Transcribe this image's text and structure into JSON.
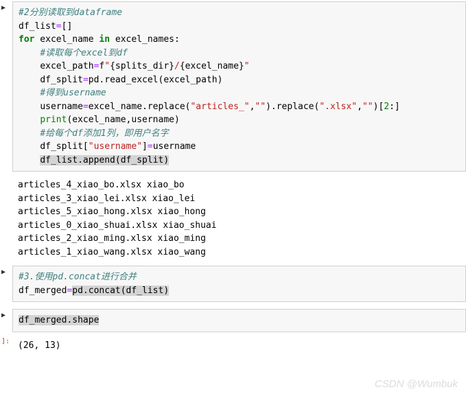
{
  "cell1": {
    "comment1": "#2分别读取到dataframe",
    "line2a": "df_list",
    "line2b": "=",
    "line2c": "[]",
    "kw_for": "for",
    "var_excel_name": " excel_name ",
    "kw_in": "in",
    "var_excel_names": " excel_names:",
    "comment2": "#读取每个excel到df",
    "line5a": "excel_path",
    "line5b": "=",
    "line5c": "f",
    "str5a": "\"",
    "line5d": "{splits_dir}",
    "str5b": "/",
    "line5e": "{excel_name}",
    "str5c": "\"",
    "line6a": "df_split",
    "line6b": "=",
    "line6c": "pd.read_excel(excel_path)",
    "comment3": "#得到username",
    "line8a": "username",
    "line8b": "=",
    "line8c": "excel_name.replace(",
    "str8a": "\"articles_\"",
    "line8d": ",",
    "str8b": "\"\"",
    "line8e": ").replace(",
    "str8c": "\".xlsx\"",
    "line8f": ",",
    "str8d": "\"\"",
    "line8g": ")[",
    "num8": "2",
    "line8h": ":]",
    "builtin_print": "print",
    "line9a": "(excel_name,username)",
    "comment4": "#给每个df添加1列，即用户名字",
    "line11a": "df_split[",
    "str11": "\"username\"",
    "line11b": "]",
    "line11c": "=",
    "line11d": "username",
    "line12": "df_list.append(df_split)"
  },
  "output1": "articles_4_xiao_bo.xlsx xiao_bo\narticles_3_xiao_lei.xlsx xiao_lei\narticles_5_xiao_hong.xlsx xiao_hong\narticles_0_xiao_shuai.xlsx xiao_shuai\narticles_2_xiao_ming.xlsx xiao_ming\narticles_1_xiao_wang.xlsx xiao_wang",
  "cell2": {
    "comment": "#3.使用pd.concat进行合并",
    "line2a": "df_merged",
    "line2b": "=",
    "line2c": "pd.concat(df_list)"
  },
  "cell3": {
    "line1": "df_merged.shape"
  },
  "output3": "(26, 13)",
  "watermark": "CSDN @Wumbuk",
  "prompt_in": "▶",
  "prompt_out": "]:"
}
